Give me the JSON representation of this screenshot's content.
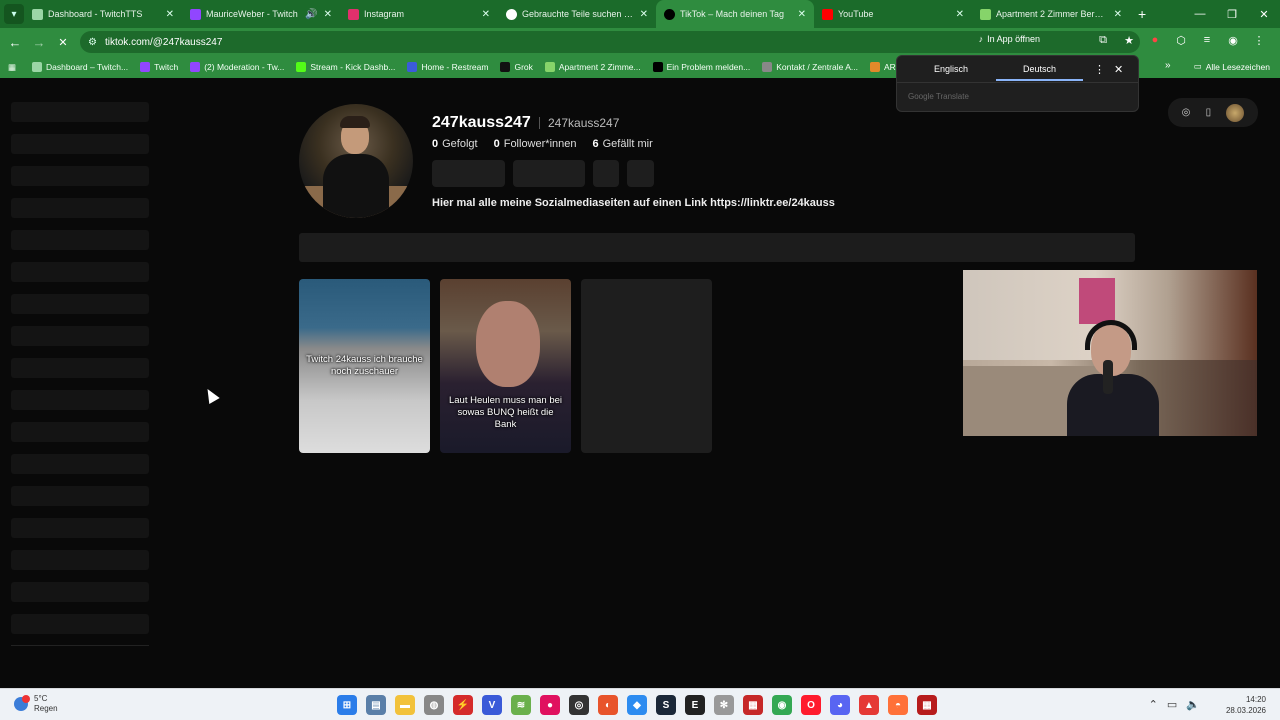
{
  "browser": {
    "tabs": [
      {
        "title": "Dashboard - TwitchTTS",
        "color": "#9bd6a6",
        "active": false
      },
      {
        "title": "MauriceWeber - Twitch",
        "color": "#9146ff",
        "active": false
      },
      {
        "title": "Instagram",
        "color": "#e1306c",
        "active": false
      },
      {
        "title": "Gebrauchte Teile suchen und fi",
        "color": "#ffffff",
        "active": false
      },
      {
        "title": "TikTok – Mach deinen Tag",
        "color": "#000000",
        "active": true
      },
      {
        "title": "YouTube",
        "color": "#ff0000",
        "active": false
      },
      {
        "title": "Apartment 2 Zimmer Bergheim",
        "color": "#86d46a",
        "active": false
      }
    ],
    "url": "tiktok.com/@247kauss247",
    "in_app_label": "In App öffnen",
    "bookmarks": [
      {
        "label": "Dashboard – Twitch...",
        "color": "#9bd6a6"
      },
      {
        "label": "Twitch",
        "color": "#9146ff"
      },
      {
        "label": "(2) Moderation - Tw...",
        "color": "#9146ff"
      },
      {
        "label": "Stream - Kick Dashb...",
        "color": "#53fc18"
      },
      {
        "label": "Home - Restream",
        "color": "#3b5bdb"
      },
      {
        "label": "Grok",
        "color": "#111111"
      },
      {
        "label": "Apartment 2 Zimme...",
        "color": "#86d46a"
      },
      {
        "label": "Ein Problem melden...",
        "color": "#000000"
      },
      {
        "label": "Kontakt / Zentrale A...",
        "color": "#888888"
      },
      {
        "label": "ARC Raiders -",
        "color": "#e08a2a"
      }
    ],
    "all_bookmarks_label": "Alle Lesezeichen"
  },
  "translate_popup": {
    "lang_source": "Englisch",
    "lang_target": "Deutsch",
    "provider": "Google Translate"
  },
  "profile": {
    "username": "247kauss247",
    "handle": "247kauss247",
    "following_count": "0",
    "following_label": "Gefolgt",
    "followers_count": "0",
    "followers_label": "Follower*innen",
    "likes_count": "6",
    "likes_label": "Gefällt mir",
    "bio": "Hier mal alle meine Sozialmediaseiten auf einen Link https://linktr.ee/24kauss"
  },
  "videos": [
    {
      "caption": "Twitch 24kauss ich brauche noch zuschauer"
    },
    {
      "caption": "Laut Heulen muss man bei sowas BUNQ heißt die Bank"
    }
  ],
  "taskbar": {
    "weather_temp": "5°C",
    "weather_desc": "Regen",
    "time": "14:20",
    "date": "28.03.2026"
  }
}
